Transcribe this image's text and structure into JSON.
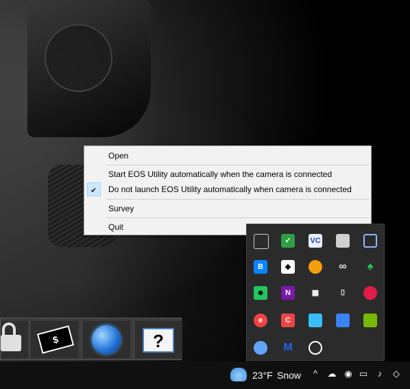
{
  "context_menu": {
    "items": [
      {
        "label": "Open",
        "checked": false
      },
      {
        "label": "Start EOS Utility automatically when the camera is connected",
        "checked": false
      },
      {
        "label": "Do not launch EOS Utility automatically when camera is connected",
        "checked": true
      },
      {
        "label": "Survey",
        "checked": false
      },
      {
        "label": "Quit",
        "checked": false
      }
    ]
  },
  "tray_overflow": {
    "icons": [
      {
        "name": "network-share-icon",
        "color": "#2b2b2b"
      },
      {
        "name": "green-shield-check-icon",
        "color": "#2ea043"
      },
      {
        "name": "vc-icon",
        "color": "#e8f0ff",
        "text": "VC"
      },
      {
        "name": "generic-app-icon",
        "color": "#cfcfcf"
      },
      {
        "name": "display-icon",
        "color": "#8fb6ff"
      },
      {
        "name": "bluetooth-icon",
        "color": "#0a84ff",
        "text": "B"
      },
      {
        "name": "windows-security-icon",
        "color": "#ffffff"
      },
      {
        "name": "orange-shield-icon",
        "color": "#f59e0b"
      },
      {
        "name": "sync-icon",
        "color": "#e5e5e5"
      },
      {
        "name": "genie-lamp-icon",
        "color": "#22c55e"
      },
      {
        "name": "green-robot-icon",
        "color": "#22c55e"
      },
      {
        "name": "onenote-icon",
        "color": "#7719aa",
        "text": "N"
      },
      {
        "name": "mosaic-icon",
        "color": "#ffffff"
      },
      {
        "name": "usb-icon",
        "color": "#ffffff"
      },
      {
        "name": "red-blue-badge-icon",
        "color": "#e11d48"
      },
      {
        "name": "red-e-icon",
        "color": "#ef4444",
        "text": "e"
      },
      {
        "name": "ccleaner-icon",
        "color": "#ef4444",
        "text": "C"
      },
      {
        "name": "screenshot-tool-icon",
        "color": "#38bdf8"
      },
      {
        "name": "blue-wand-icon",
        "color": "#3b82f6"
      },
      {
        "name": "nvidia-icon",
        "color": "#76b900"
      },
      {
        "name": "cloud-icon",
        "color": "#60a5fa"
      },
      {
        "name": "malwarebytes-icon",
        "color": "#1e40af",
        "text": "M"
      },
      {
        "name": "record-circle-icon",
        "color": "#ffffff"
      }
    ]
  },
  "taskbar": {
    "weather_temp": "23°F",
    "weather_condition": "Snow"
  },
  "dock": {
    "money_symbol": "$",
    "help_symbol": "?"
  }
}
